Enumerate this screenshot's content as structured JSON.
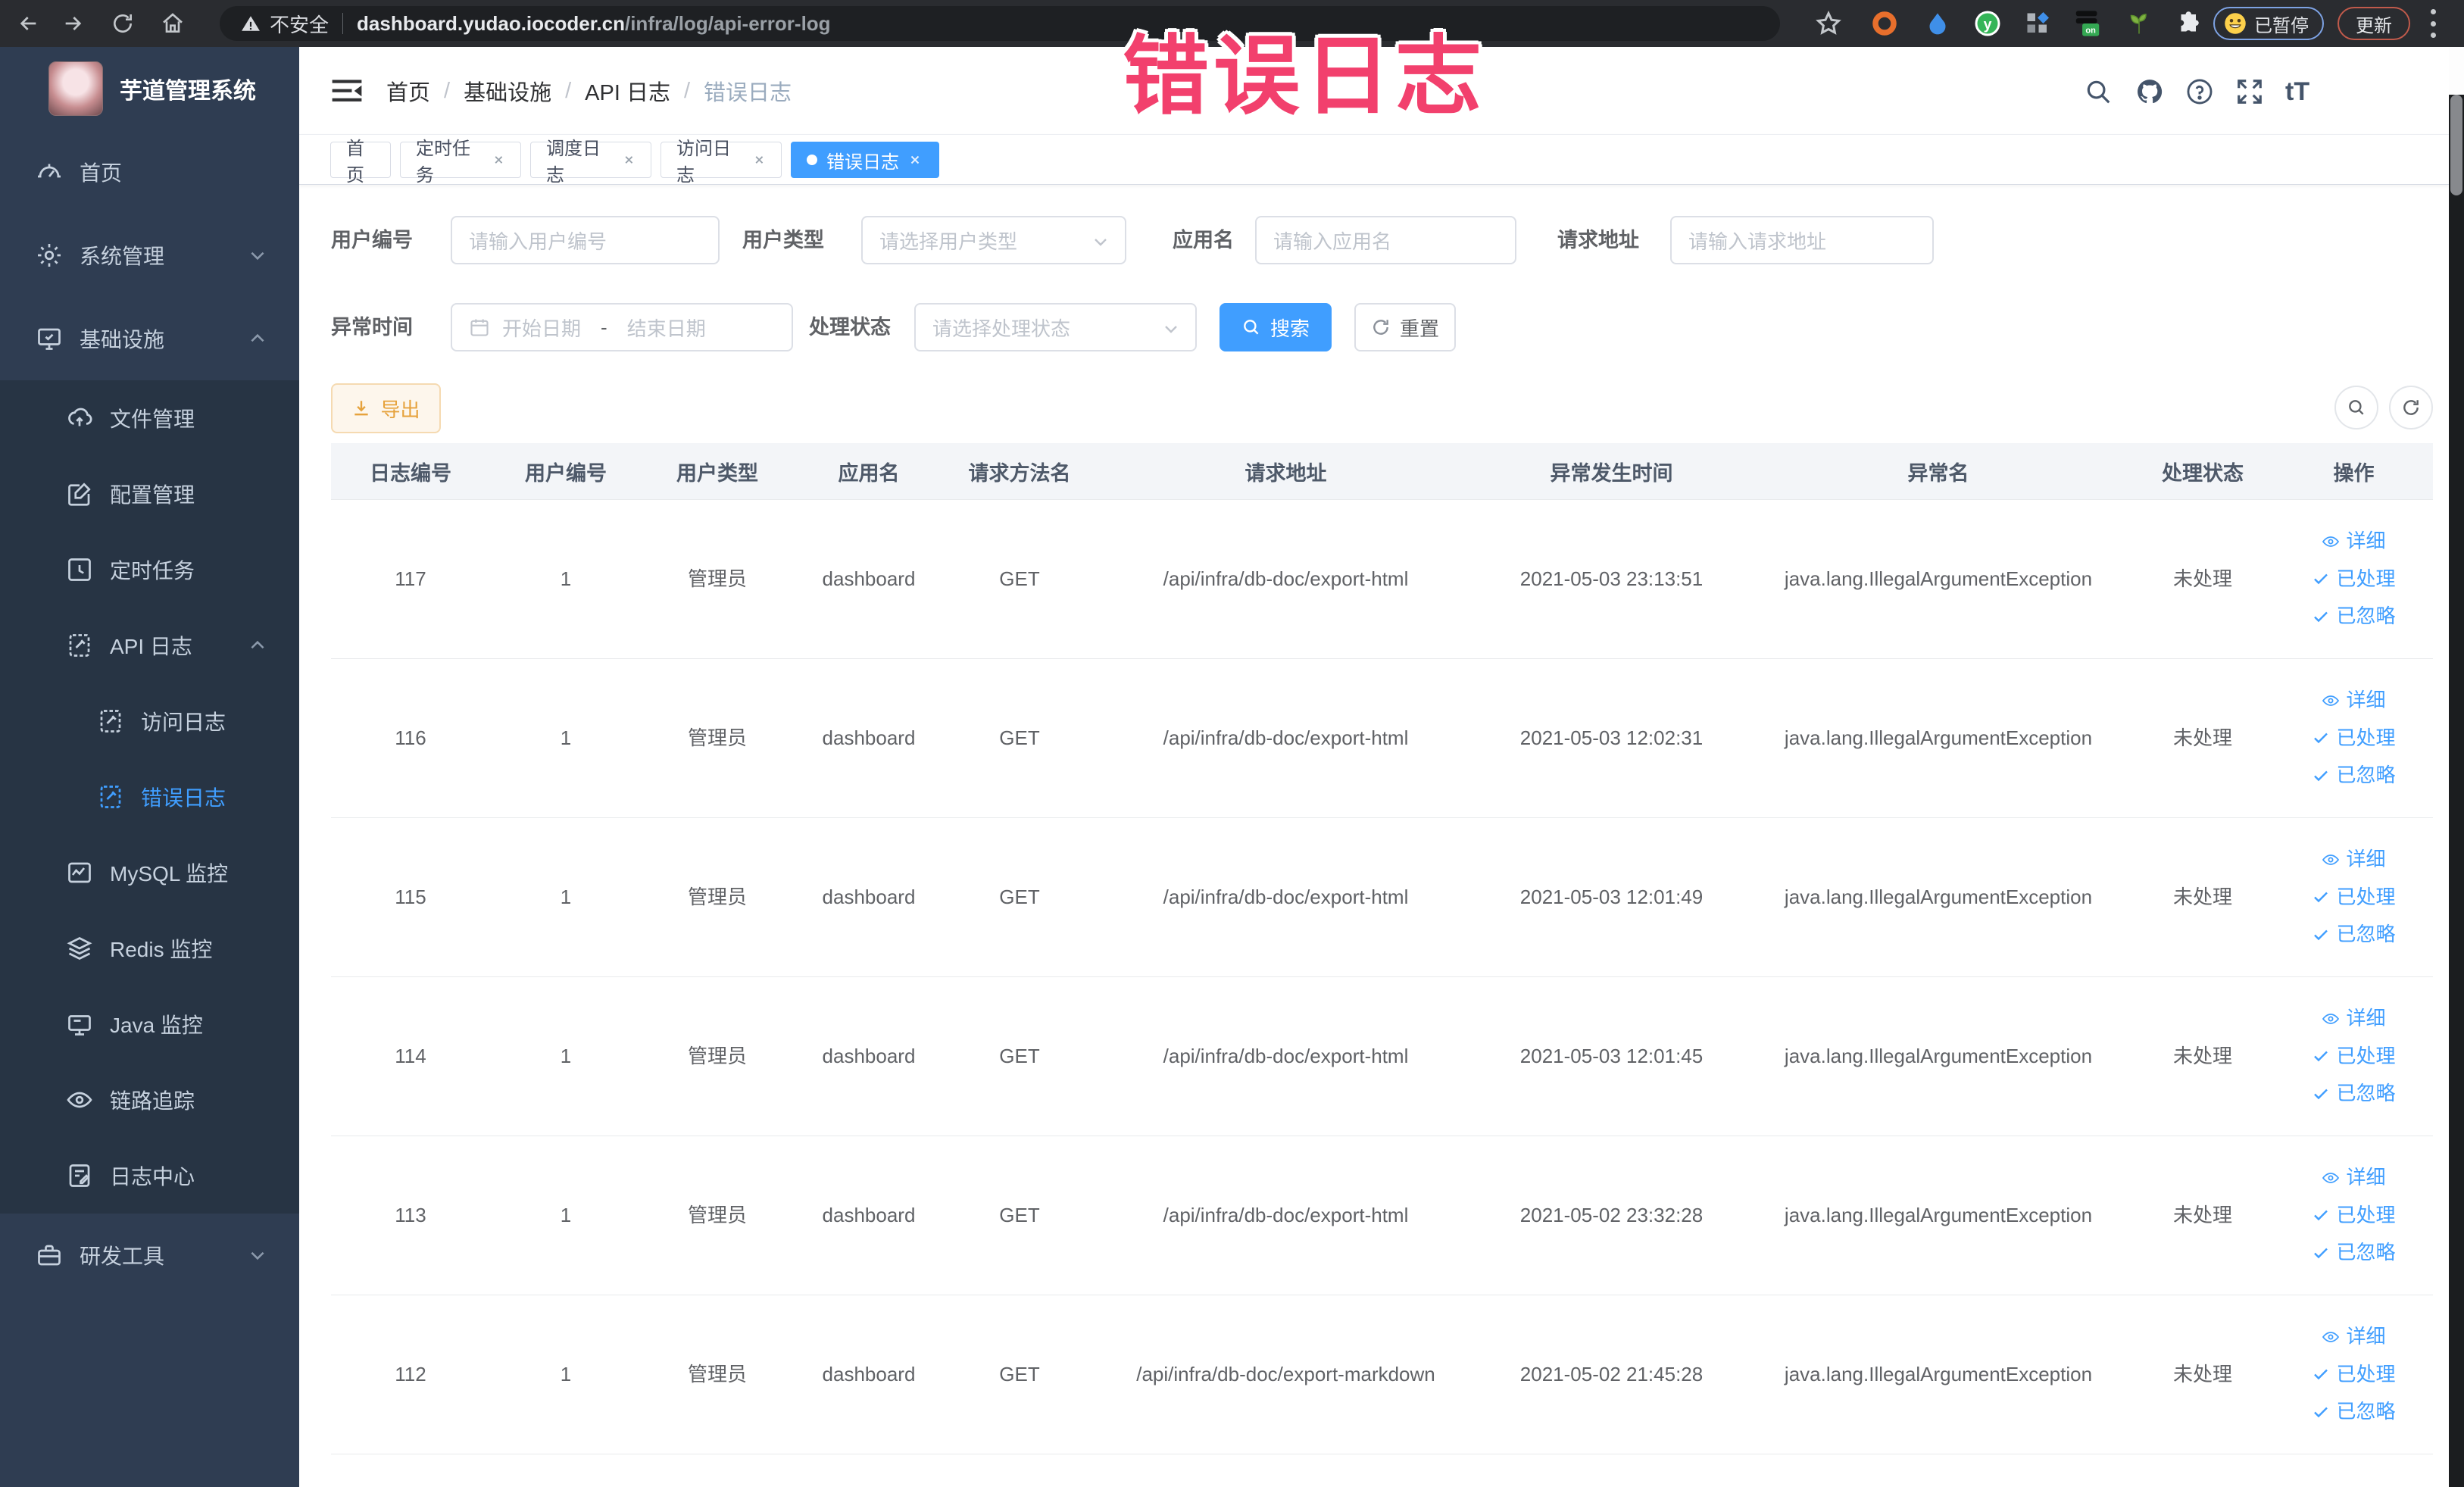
{
  "browser": {
    "security_label": "不安全",
    "url_host": "dashboard.yudao.iocoder.cn",
    "url_path": "/infra/log/api-error-log",
    "paused_button": "已暂停",
    "update_button": "更新",
    "extension_on_badge": "on"
  },
  "annotation": {
    "text": "错误日志",
    "color": "#f2406d"
  },
  "sidebar": {
    "title": "芋道管理系统",
    "items": {
      "home": "首页",
      "system": "系统管理",
      "infra": "基础设施",
      "file": "文件管理",
      "config": "配置管理",
      "job": "定时任务",
      "api_log": "API 日志",
      "access_log": "访问日志",
      "error_log": "错误日志",
      "mysql": "MySQL 监控",
      "redis": "Redis 监控",
      "java": "Java 监控",
      "trace": "链路追踪",
      "log_center": "日志中心",
      "dev_tools": "研发工具"
    }
  },
  "header": {
    "breadcrumb": [
      "首页",
      "基础设施",
      "API 日志",
      "错误日志"
    ],
    "breadcrumb_separator": "/",
    "font_size_label": "tT"
  },
  "tabs": [
    {
      "label": "首页"
    },
    {
      "label": "定时任务"
    },
    {
      "label": "调度日志"
    },
    {
      "label": "访问日志"
    },
    {
      "label": "错误日志"
    }
  ],
  "filters": {
    "user_id_label": "用户编号",
    "user_id_placeholder": "请输入用户编号",
    "user_type_label": "用户类型",
    "user_type_placeholder": "请选择用户类型",
    "app_name_label": "应用名",
    "app_name_placeholder": "请输入应用名",
    "request_url_label": "请求地址",
    "request_url_placeholder": "请输入请求地址",
    "exception_time_label": "异常时间",
    "date_start_placeholder": "开始日期",
    "date_separator": "-",
    "date_end_placeholder": "结束日期",
    "process_status_label": "处理状态",
    "process_status_placeholder": "请选择处理状态",
    "search_button": "搜索",
    "reset_button": "重置"
  },
  "toolbar": {
    "export_button": "导出"
  },
  "table": {
    "columns": [
      "日志编号",
      "用户编号",
      "用户类型",
      "应用名",
      "请求方法名",
      "请求地址",
      "异常发生时间",
      "异常名",
      "处理状态",
      "操作"
    ],
    "row_actions": {
      "detail": "详细",
      "processed": "已处理",
      "ignored": "已忽略"
    },
    "rows": [
      {
        "id": "117",
        "user_id": "1",
        "user_type": "管理员",
        "app": "dashboard",
        "method": "GET",
        "url": "/api/infra/db-doc/export-html",
        "time": "2021-05-03 23:13:51",
        "exception": "java.lang.IllegalArgumentException",
        "status": "未处理"
      },
      {
        "id": "116",
        "user_id": "1",
        "user_type": "管理员",
        "app": "dashboard",
        "method": "GET",
        "url": "/api/infra/db-doc/export-html",
        "time": "2021-05-03 12:02:31",
        "exception": "java.lang.IllegalArgumentException",
        "status": "未处理"
      },
      {
        "id": "115",
        "user_id": "1",
        "user_type": "管理员",
        "app": "dashboard",
        "method": "GET",
        "url": "/api/infra/db-doc/export-html",
        "time": "2021-05-03 12:01:49",
        "exception": "java.lang.IllegalArgumentException",
        "status": "未处理"
      },
      {
        "id": "114",
        "user_id": "1",
        "user_type": "管理员",
        "app": "dashboard",
        "method": "GET",
        "url": "/api/infra/db-doc/export-html",
        "time": "2021-05-03 12:01:45",
        "exception": "java.lang.IllegalArgumentException",
        "status": "未处理"
      },
      {
        "id": "113",
        "user_id": "1",
        "user_type": "管理员",
        "app": "dashboard",
        "method": "GET",
        "url": "/api/infra/db-doc/export-html",
        "time": "2021-05-02 23:32:28",
        "exception": "java.lang.IllegalArgumentException",
        "status": "未处理"
      },
      {
        "id": "112",
        "user_id": "1",
        "user_type": "管理员",
        "app": "dashboard",
        "method": "GET",
        "url": "/api/infra/db-doc/export-markdown",
        "time": "2021-05-02 21:45:28",
        "exception": "java.lang.IllegalArgumentException",
        "status": "未处理"
      }
    ]
  }
}
